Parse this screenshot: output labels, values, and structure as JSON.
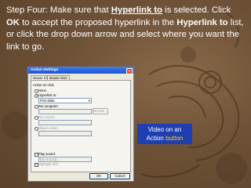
{
  "instruction": {
    "t1": "Step Four:  Make sure that ",
    "t2": "Hyperlink to",
    "t3": " is selected. Click ",
    "t4": "OK",
    "t5": " to accept the proposed hyperlink in the ",
    "t6": "Hyperlink to",
    "t7": " list, or click the drop down arrow and select where you want the link to go."
  },
  "dialog": {
    "title": "Action Settings",
    "close_glyph": "×",
    "tabs": [
      "Mouse Click",
      "Mouse Over"
    ],
    "action_group": "Action on click",
    "none_label": "None",
    "hyperlink_label": "Hyperlink to:",
    "hyperlink_value": "First Slide",
    "run_program_label": "Run program:",
    "browse_label": "Browse...",
    "run_macro_label": "Run macro:",
    "object_action_label": "Object action:",
    "play_sound_label": "Play sound:",
    "sound_value": "[No Sound]",
    "highlight_label": "Highlight click",
    "ok_label": "OK",
    "cancel_label": "Cancel"
  },
  "callout": {
    "line1": "Video on an",
    "line2a": "Action ",
    "line2b": "button"
  },
  "colors": {
    "background": "#6e5237",
    "callout_bg": "#1f3fb0",
    "callout_highlight": "#ffd11a",
    "titlebar": "#1c55d0"
  }
}
